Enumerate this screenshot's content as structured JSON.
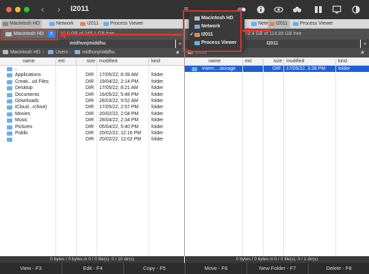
{
  "window": {
    "title": "I2011"
  },
  "colors": {
    "accent": "#1f5fd6",
    "annotation": "#e5322d",
    "stepper": "#3b82f6"
  },
  "toolbar_icons": [
    "menu-icon",
    "list-icon",
    "grid-icon",
    "toggle-icon",
    "info-icon",
    "eye-icon",
    "binoculars-icon",
    "panels-icon",
    "monitor-icon",
    "dark-mode-icon"
  ],
  "left_tabs": [
    "Macintosh HD",
    "Network",
    "I2011",
    "Process Viewer"
  ],
  "right_tabs": [
    "Network",
    "I2011",
    "Process Viewer"
  ],
  "left_drive": {
    "label": "Macintosh HD",
    "free": "13.0 GB of 245.1 GB free"
  },
  "right_drive": {
    "free": "72.4 GB of 114.85 GB free"
  },
  "left_title": "midhunjmiddhu",
  "right_title": "I2011",
  "left_breadcrumb": [
    "Macintosh HD",
    "Users",
    "midhunjmiddhu"
  ],
  "right_breadcrumb": [
    "I2011"
  ],
  "columns": {
    "name": "name",
    "ext": "ext",
    "size": "size",
    "modified": "modified",
    "kind": "kind"
  },
  "left_files": [
    {
      "name": "..",
      "size": "",
      "modified": "",
      "kind": ""
    },
    {
      "name": "Applications",
      "size": "DIR",
      "modified": "17/05/22, 8:39 AM",
      "kind": "folder"
    },
    {
      "name": "Creati...ud Files",
      "size": "DIR",
      "modified": "19/04/22, 2:14 PM",
      "kind": "folder"
    },
    {
      "name": "Desktop",
      "size": "DIR",
      "modified": "17/05/22, 8:21 AM",
      "kind": "folder"
    },
    {
      "name": "Documents",
      "size": "DIR",
      "modified": "16/05/22, 5:48 PM",
      "kind": "folder"
    },
    {
      "name": "Downloads",
      "size": "DIR",
      "modified": "28/03/22, 9:52 AM",
      "kind": "folder"
    },
    {
      "name": "iCloud...rchive)",
      "size": "DIR",
      "modified": "17/05/22, 2:57 PM",
      "kind": "folder"
    },
    {
      "name": "Movies",
      "size": "DIR",
      "modified": "20/02/22, 2:04 PM",
      "kind": "folder"
    },
    {
      "name": "Music",
      "size": "DIR",
      "modified": "28/04/22, 2:34 PM",
      "kind": "folder"
    },
    {
      "name": "Pictures",
      "size": "DIR",
      "modified": "05/04/22, 5:40 PM",
      "kind": "folder"
    },
    {
      "name": "Public",
      "size": "DIR",
      "modified": "20/02/22, 12:16 PM",
      "kind": "folder"
    },
    {
      "name": "",
      "size": "DIR",
      "modified": "20/02/22, 12:02 PM",
      "kind": "folder"
    }
  ],
  "right_files": [
    {
      "name": "Intern....storage",
      "size": "DIR",
      "modified": "17/05/22, 3:28 PM",
      "kind": "folder"
    }
  ],
  "left_status": "0 bytes / 0 bytes in 0 / 0 file(s). 0 / 10 dir(s)",
  "right_status": "0 bytes / 0 bytes in 0 / 0 file(s). 0 / 1 dir(s)",
  "fkeys": [
    "View - F3",
    "Edit - F4",
    "Copy - F5",
    "Move - F6",
    "New Folder - F7",
    "Delete - F8"
  ],
  "dropdown": [
    {
      "label": "Macintosh HD",
      "checked": false
    },
    {
      "label": "Network",
      "checked": false
    },
    {
      "label": "I2011",
      "checked": true
    },
    {
      "label": "Process Viewer",
      "checked": false
    }
  ],
  "check_mark": "✓"
}
